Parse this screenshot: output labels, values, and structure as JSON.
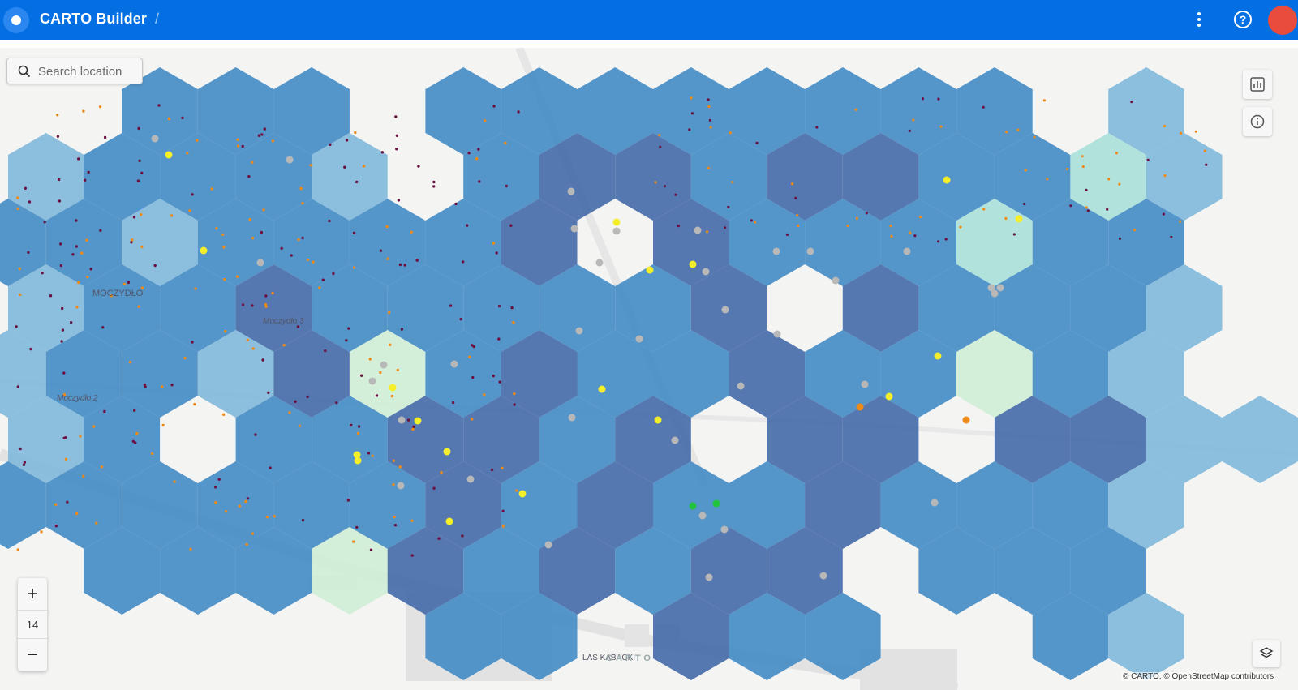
{
  "app": {
    "title": "CARTO Builder",
    "separator": "/"
  },
  "header": {
    "menu_icon": "kebab-menu-icon",
    "help_icon": "help-circle-icon",
    "help_glyph": "?",
    "avatar_color": "#e94b3c",
    "bar_color": "#036fe2"
  },
  "search": {
    "placeholder": "Search location",
    "value": ""
  },
  "map_tools": {
    "widgets_icon": "bar-chart-icon",
    "info_icon": "info-icon",
    "layers_icon": "layers-icon"
  },
  "zoom": {
    "in_label": "+",
    "out_label": "−",
    "level": "14"
  },
  "labels": {
    "district": "MOCZYDŁO",
    "street_a": "Moczydło 3",
    "street_b": "Moczydło 2",
    "forest": "LAS KABACKI",
    "watermark": "CARTO"
  },
  "attribution": "© CARTO, © OpenStreetMap contributors",
  "colors": {
    "hex_light": "#7db6d9",
    "hex_mid": "#3d88c4",
    "hex_dark": "#3f67a6",
    "hex_green": "#cfeed5",
    "hex_teal": "#a7e0d8",
    "point_yellow": "#f5ef2a",
    "point_grey": "#b8b8b8",
    "point_orange": "#ef8a16",
    "point_darkred": "#6b1142",
    "point_green": "#22c43c"
  }
}
